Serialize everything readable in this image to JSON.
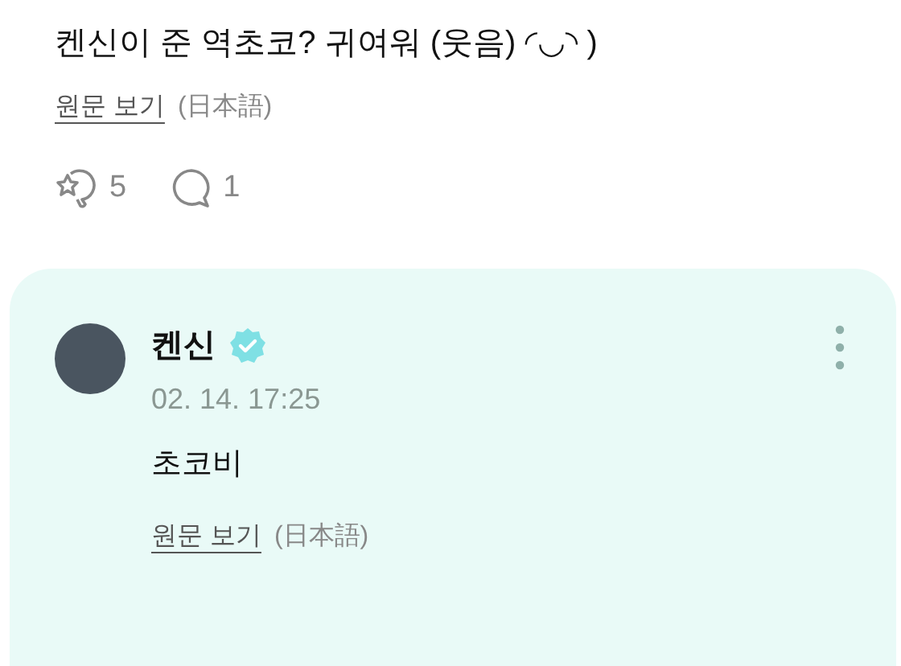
{
  "post": {
    "text": "켄신이 준 역초코? 귀여워 (웃음) ◜◡◝ )",
    "original_link": "원문 보기",
    "language": "(日本語)",
    "reaction_count": "5",
    "comment_count": "1"
  },
  "reply": {
    "author": "켄신",
    "verified": true,
    "time": "02. 14. 17:25",
    "text": "초코비",
    "original_link": "원문 보기",
    "language": "(日本語)"
  }
}
